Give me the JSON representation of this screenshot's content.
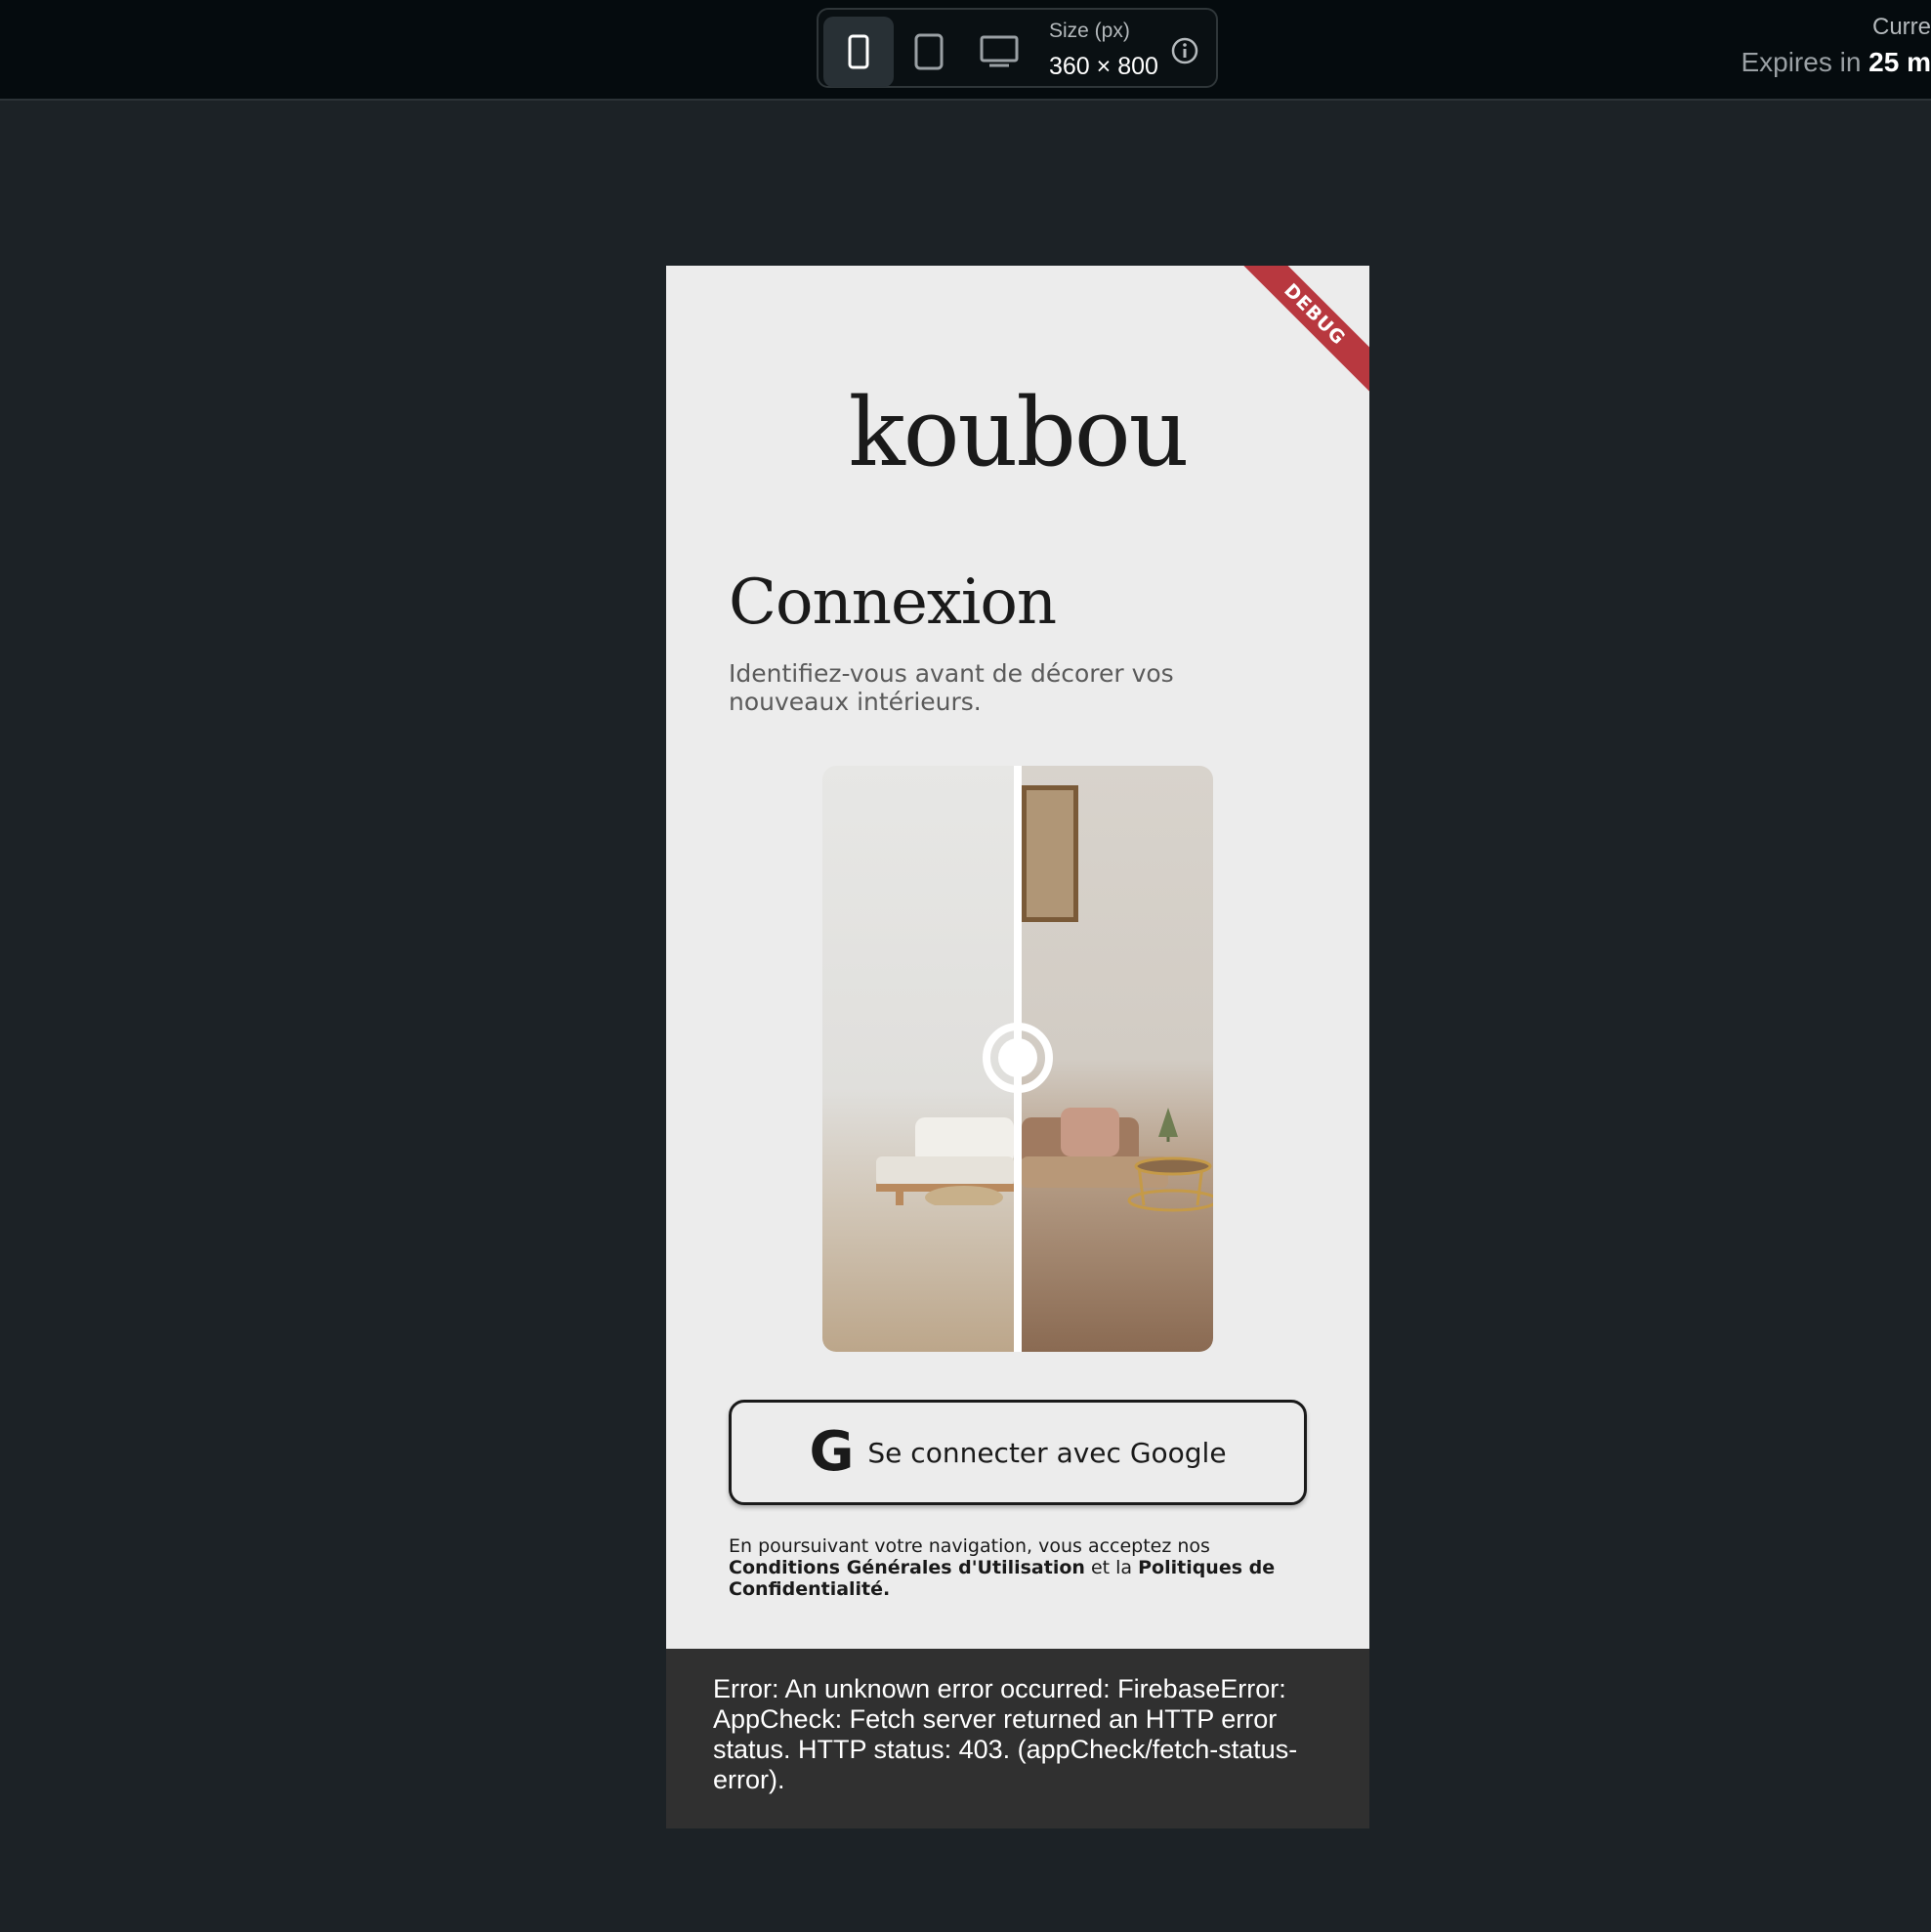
{
  "toolbar": {
    "size_label": "Size (px)",
    "size_value": "360 × 800",
    "devices": [
      "phone-icon",
      "tablet-icon",
      "desktop-icon"
    ],
    "active_device": "phone"
  },
  "meta": {
    "line1": "Curre",
    "expires_prefix": "Expires in ",
    "expires_value": "25 m"
  },
  "app": {
    "debug_banner": "DEBUG",
    "logo": "koubou",
    "title": "Connexion",
    "subtitle": "Identifiez-vous avant de décorer vos nouveaux intérieurs.",
    "google_icon": "G",
    "google_button": "Se connecter avec Google",
    "legal": {
      "prefix": "En poursuivant votre navigation, vous acceptez nos ",
      "terms": "Conditions Générales d'Utilisation",
      "middle": " et la ",
      "privacy": "Politiques de Confidentialité",
      "suffix": "."
    }
  },
  "error": {
    "message": "Error: An unknown error occurred: FirebaseError: AppCheck: Fetch server returned an HTTP error status. HTTP status: 403. (appCheck/fetch-status-error)."
  },
  "colors": {
    "page_bg": "#1c2226",
    "topbar_bg": "#050b0e",
    "phone_bg": "#ececec",
    "debug_red": "#b8383f",
    "error_bg": "#303030"
  }
}
